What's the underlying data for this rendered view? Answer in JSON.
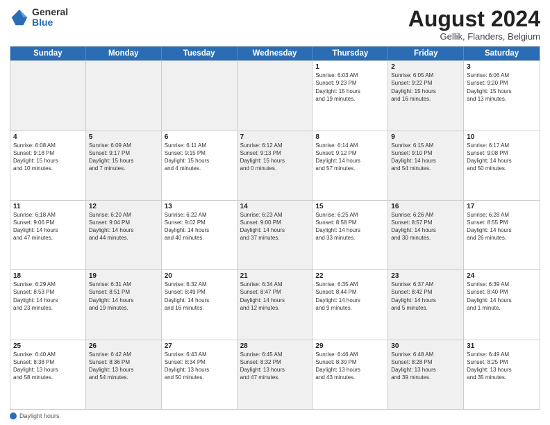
{
  "logo": {
    "general": "General",
    "blue": "Blue"
  },
  "title": "August 2024",
  "location": "Gellik, Flanders, Belgium",
  "days_of_week": [
    "Sunday",
    "Monday",
    "Tuesday",
    "Wednesday",
    "Thursday",
    "Friday",
    "Saturday"
  ],
  "weeks": [
    [
      {
        "day": "",
        "data": "",
        "shaded": true
      },
      {
        "day": "",
        "data": "",
        "shaded": true
      },
      {
        "day": "",
        "data": "",
        "shaded": true
      },
      {
        "day": "",
        "data": "",
        "shaded": true
      },
      {
        "day": "1",
        "data": "Sunrise: 6:03 AM\nSunset: 9:23 PM\nDaylight: 15 hours\nand 19 minutes.",
        "shaded": false
      },
      {
        "day": "2",
        "data": "Sunrise: 6:05 AM\nSunset: 9:22 PM\nDaylight: 15 hours\nand 16 minutes.",
        "shaded": true
      },
      {
        "day": "3",
        "data": "Sunrise: 6:06 AM\nSunset: 9:20 PM\nDaylight: 15 hours\nand 13 minutes.",
        "shaded": false
      }
    ],
    [
      {
        "day": "4",
        "data": "Sunrise: 6:08 AM\nSunset: 9:18 PM\nDaylight: 15 hours\nand 10 minutes.",
        "shaded": false
      },
      {
        "day": "5",
        "data": "Sunrise: 6:09 AM\nSunset: 9:17 PM\nDaylight: 15 hours\nand 7 minutes.",
        "shaded": true
      },
      {
        "day": "6",
        "data": "Sunrise: 6:11 AM\nSunset: 9:15 PM\nDaylight: 15 hours\nand 4 minutes.",
        "shaded": false
      },
      {
        "day": "7",
        "data": "Sunrise: 6:12 AM\nSunset: 9:13 PM\nDaylight: 15 hours\nand 0 minutes.",
        "shaded": true
      },
      {
        "day": "8",
        "data": "Sunrise: 6:14 AM\nSunset: 9:12 PM\nDaylight: 14 hours\nand 57 minutes.",
        "shaded": false
      },
      {
        "day": "9",
        "data": "Sunrise: 6:15 AM\nSunset: 9:10 PM\nDaylight: 14 hours\nand 54 minutes.",
        "shaded": true
      },
      {
        "day": "10",
        "data": "Sunrise: 6:17 AM\nSunset: 9:08 PM\nDaylight: 14 hours\nand 50 minutes.",
        "shaded": false
      }
    ],
    [
      {
        "day": "11",
        "data": "Sunrise: 6:18 AM\nSunset: 9:06 PM\nDaylight: 14 hours\nand 47 minutes.",
        "shaded": false
      },
      {
        "day": "12",
        "data": "Sunrise: 6:20 AM\nSunset: 9:04 PM\nDaylight: 14 hours\nand 44 minutes.",
        "shaded": true
      },
      {
        "day": "13",
        "data": "Sunrise: 6:22 AM\nSunset: 9:02 PM\nDaylight: 14 hours\nand 40 minutes.",
        "shaded": false
      },
      {
        "day": "14",
        "data": "Sunrise: 6:23 AM\nSunset: 9:00 PM\nDaylight: 14 hours\nand 37 minutes.",
        "shaded": true
      },
      {
        "day": "15",
        "data": "Sunrise: 6:25 AM\nSunset: 8:58 PM\nDaylight: 14 hours\nand 33 minutes.",
        "shaded": false
      },
      {
        "day": "16",
        "data": "Sunrise: 6:26 AM\nSunset: 8:57 PM\nDaylight: 14 hours\nand 30 minutes.",
        "shaded": true
      },
      {
        "day": "17",
        "data": "Sunrise: 6:28 AM\nSunset: 8:55 PM\nDaylight: 14 hours\nand 26 minutes.",
        "shaded": false
      }
    ],
    [
      {
        "day": "18",
        "data": "Sunrise: 6:29 AM\nSunset: 8:53 PM\nDaylight: 14 hours\nand 23 minutes.",
        "shaded": false
      },
      {
        "day": "19",
        "data": "Sunrise: 6:31 AM\nSunset: 8:51 PM\nDaylight: 14 hours\nand 19 minutes.",
        "shaded": true
      },
      {
        "day": "20",
        "data": "Sunrise: 6:32 AM\nSunset: 8:49 PM\nDaylight: 14 hours\nand 16 minutes.",
        "shaded": false
      },
      {
        "day": "21",
        "data": "Sunrise: 6:34 AM\nSunset: 8:47 PM\nDaylight: 14 hours\nand 12 minutes.",
        "shaded": true
      },
      {
        "day": "22",
        "data": "Sunrise: 6:35 AM\nSunset: 8:44 PM\nDaylight: 14 hours\nand 9 minutes.",
        "shaded": false
      },
      {
        "day": "23",
        "data": "Sunrise: 6:37 AM\nSunset: 8:42 PM\nDaylight: 14 hours\nand 5 minutes.",
        "shaded": true
      },
      {
        "day": "24",
        "data": "Sunrise: 6:39 AM\nSunset: 8:40 PM\nDaylight: 14 hours\nand 1 minute.",
        "shaded": false
      }
    ],
    [
      {
        "day": "25",
        "data": "Sunrise: 6:40 AM\nSunset: 8:38 PM\nDaylight: 13 hours\nand 58 minutes.",
        "shaded": false
      },
      {
        "day": "26",
        "data": "Sunrise: 6:42 AM\nSunset: 8:36 PM\nDaylight: 13 hours\nand 54 minutes.",
        "shaded": true
      },
      {
        "day": "27",
        "data": "Sunrise: 6:43 AM\nSunset: 8:34 PM\nDaylight: 13 hours\nand 50 minutes.",
        "shaded": false
      },
      {
        "day": "28",
        "data": "Sunrise: 6:45 AM\nSunset: 8:32 PM\nDaylight: 13 hours\nand 47 minutes.",
        "shaded": true
      },
      {
        "day": "29",
        "data": "Sunrise: 6:46 AM\nSunset: 8:30 PM\nDaylight: 13 hours\nand 43 minutes.",
        "shaded": false
      },
      {
        "day": "30",
        "data": "Sunrise: 6:48 AM\nSunset: 8:28 PM\nDaylight: 13 hours\nand 39 minutes.",
        "shaded": true
      },
      {
        "day": "31",
        "data": "Sunrise: 6:49 AM\nSunset: 8:25 PM\nDaylight: 13 hours\nand 35 minutes.",
        "shaded": false
      }
    ]
  ],
  "footer": {
    "label": "Daylight hours"
  }
}
